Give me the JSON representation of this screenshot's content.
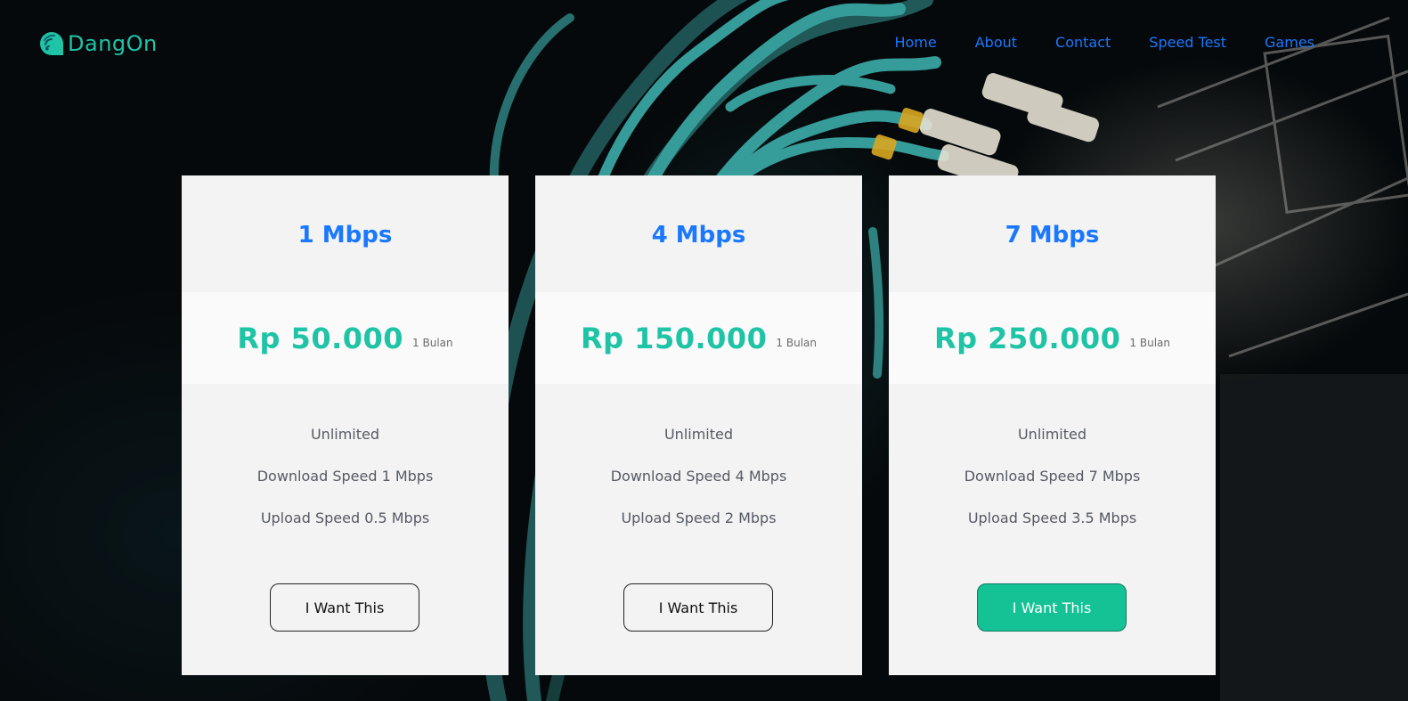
{
  "brand": {
    "name": "DangOn",
    "color": "#1fc3a5"
  },
  "nav": {
    "color": "#1a78ff",
    "items": [
      "Home",
      "About",
      "Contact",
      "Speed Test",
      "Games"
    ]
  },
  "plans": [
    {
      "title": "1 Mbps",
      "price": "Rp 50.000",
      "period": "1 Bulan",
      "features": [
        "Unlimited",
        "Download Speed 1 Mbps",
        "Upload Speed 0.5 Mbps"
      ],
      "button": "I Want This",
      "highlighted": false
    },
    {
      "title": "4 Mbps",
      "price": "Rp 150.000",
      "period": "1 Bulan",
      "features": [
        "Unlimited",
        "Download Speed 4 Mbps",
        "Upload Speed 2 Mbps"
      ],
      "button": "I Want This",
      "highlighted": false
    },
    {
      "title": "7 Mbps",
      "price": "Rp 250.000",
      "period": "1 Bulan",
      "features": [
        "Unlimited",
        "Download Speed 7 Mbps",
        "Upload Speed 3.5 Mbps"
      ],
      "button": "I Want This",
      "highlighted": true
    }
  ],
  "colors": {
    "accent": "#1fc3a5",
    "button_active": "#14c295",
    "title_blue": "#1a78ff",
    "card_bg": "#f3f3f3"
  },
  "icons": {
    "logo": "wifi-chat-bubble-icon"
  }
}
